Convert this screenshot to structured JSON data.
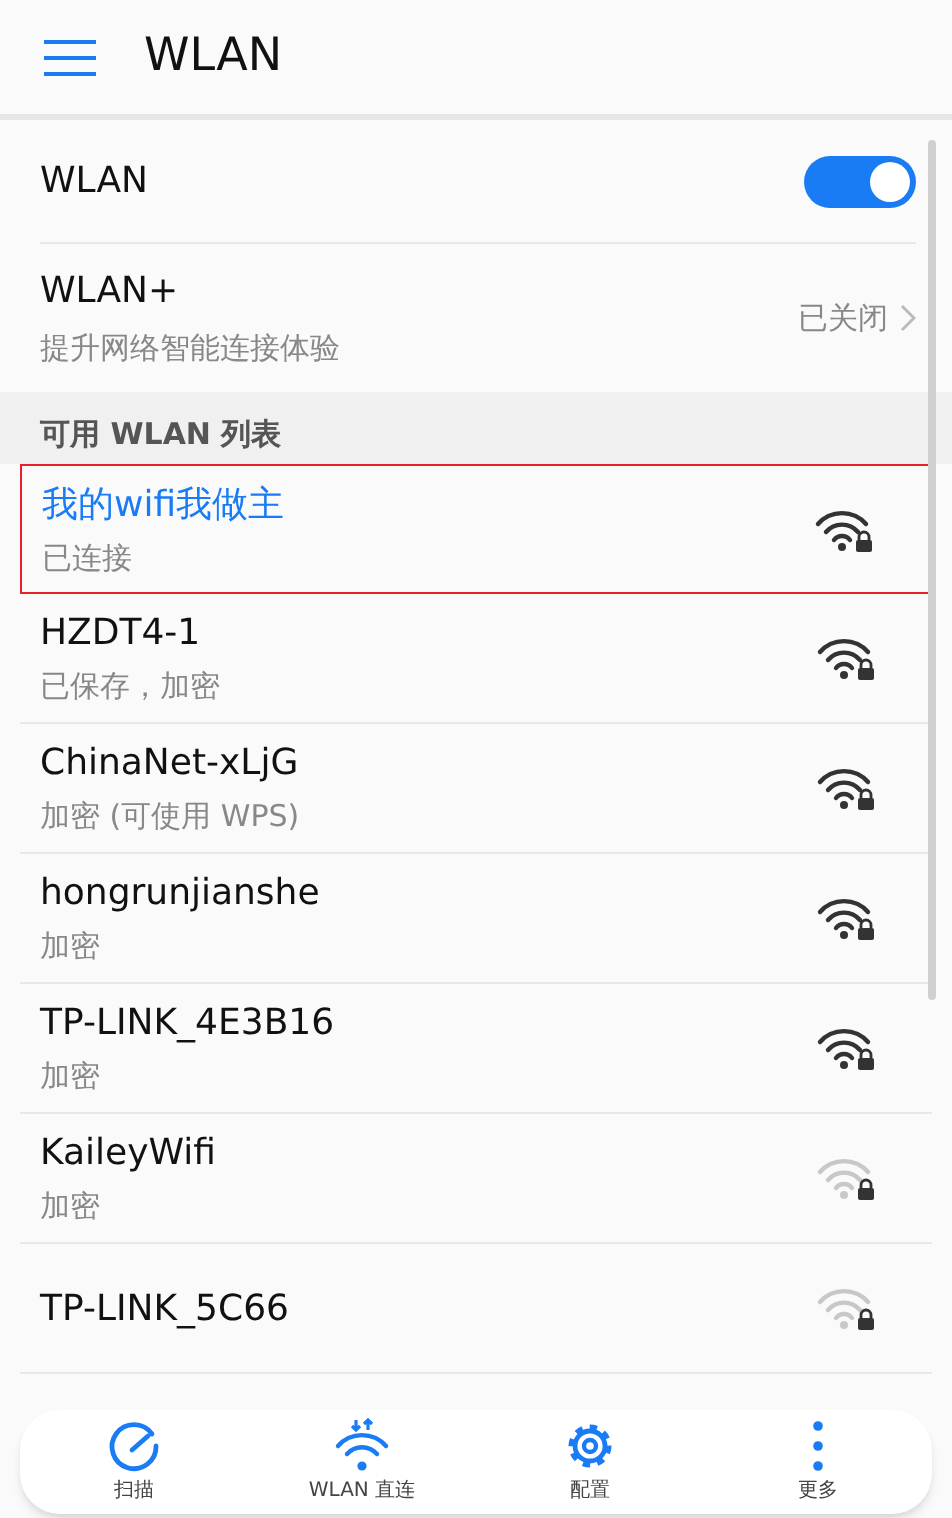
{
  "header": {
    "title": "WLAN"
  },
  "wlan_toggle": {
    "label": "WLAN",
    "on": true
  },
  "wlan_plus": {
    "label": "WLAN+",
    "description": "提升网络智能连接体验",
    "status": "已关闭"
  },
  "section_title": "可用 WLAN 列表",
  "networks": [
    {
      "name": "我的wifi我做主",
      "status": "已连接",
      "connected": true,
      "highlighted": true,
      "weak": false
    },
    {
      "name": "HZDT4-1",
      "status": "已保存，加密",
      "connected": false,
      "highlighted": false,
      "weak": false
    },
    {
      "name": "ChinaNet-xLjG",
      "status": "加密 (可使用 WPS)",
      "connected": false,
      "highlighted": false,
      "weak": false
    },
    {
      "name": "hongrunjianshe",
      "status": "加密",
      "connected": false,
      "highlighted": false,
      "weak": false
    },
    {
      "name": "TP-LINK_4E3B16",
      "status": "加密",
      "connected": false,
      "highlighted": false,
      "weak": false
    },
    {
      "name": "KaileyWifi",
      "status": "加密",
      "connected": false,
      "highlighted": false,
      "weak": true
    },
    {
      "name": "TP-LINK_5C66",
      "connected": false,
      "highlighted": false,
      "weak": true
    }
  ],
  "bottom_bar": [
    {
      "kind": "scan",
      "label": "扫描"
    },
    {
      "kind": "direct",
      "label": "WLAN 直连"
    },
    {
      "kind": "config",
      "label": "配置"
    },
    {
      "kind": "more",
      "label": "更多"
    }
  ]
}
